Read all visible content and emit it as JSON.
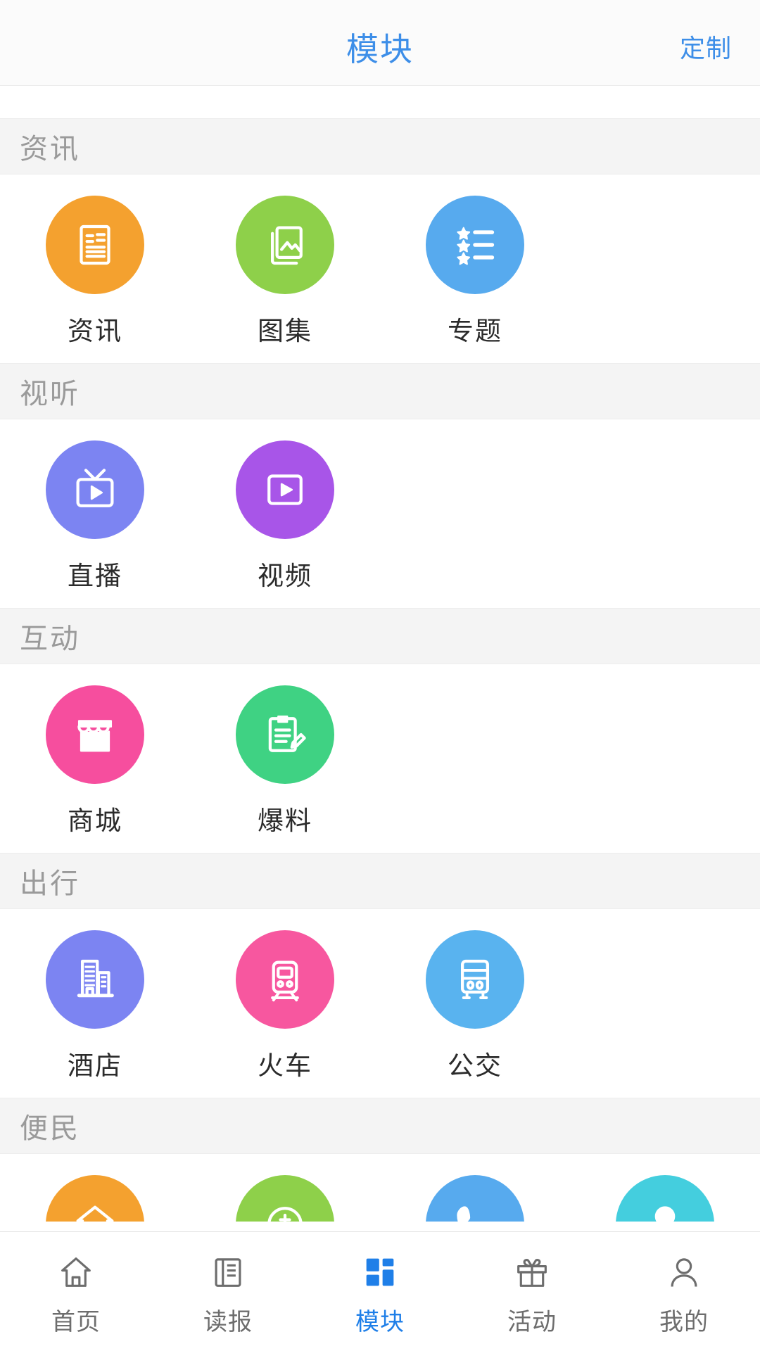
{
  "header": {
    "title": "模块",
    "action_label": "定制",
    "accent_color": "#3d8ee8"
  },
  "sections": [
    {
      "name": "资讯",
      "items": [
        {
          "label": "资讯",
          "icon": "news-document-icon",
          "color": "#f4a12f"
        },
        {
          "label": "图集",
          "icon": "photo-gallery-icon",
          "color": "#8ed04a"
        },
        {
          "label": "专题",
          "icon": "star-list-icon",
          "color": "#57aaee"
        }
      ]
    },
    {
      "name": "视听",
      "items": [
        {
          "label": "直播",
          "icon": "tv-live-icon",
          "color": "#7c84f2"
        },
        {
          "label": "视频",
          "icon": "video-play-icon",
          "color": "#a855e8"
        }
      ]
    },
    {
      "name": "互动",
      "items": [
        {
          "label": "商城",
          "icon": "store-shop-icon",
          "color": "#f64e9e"
        },
        {
          "label": "爆料",
          "icon": "clipboard-pen-icon",
          "color": "#3fd283"
        }
      ]
    },
    {
      "name": "出行",
      "items": [
        {
          "label": "酒店",
          "icon": "hotel-building-icon",
          "color": "#7c84f2"
        },
        {
          "label": "火车",
          "icon": "train-icon",
          "color": "#f7579f"
        },
        {
          "label": "公交",
          "icon": "bus-icon",
          "color": "#59b3ef"
        }
      ]
    },
    {
      "name": "便民",
      "clipped": true,
      "items": [
        {
          "label": "",
          "icon": "house-money-icon",
          "color": "#f4a12f"
        },
        {
          "label": "",
          "icon": "coin-icon",
          "color": "#8ed04a"
        },
        {
          "label": "",
          "icon": "phone-icon",
          "color": "#57aaee"
        },
        {
          "label": "",
          "icon": "person-icon",
          "color": "#44cede"
        }
      ]
    }
  ],
  "bottom_nav": {
    "active_color": "#1f7fe8",
    "inactive_color": "#6d6d6d",
    "items": [
      {
        "label": "首页",
        "icon": "home-icon",
        "active": false
      },
      {
        "label": "读报",
        "icon": "newspaper-icon",
        "active": false
      },
      {
        "label": "模块",
        "icon": "modules-grid-icon",
        "active": true
      },
      {
        "label": "活动",
        "icon": "gift-icon",
        "active": false
      },
      {
        "label": "我的",
        "icon": "user-profile-icon",
        "active": false
      }
    ]
  }
}
